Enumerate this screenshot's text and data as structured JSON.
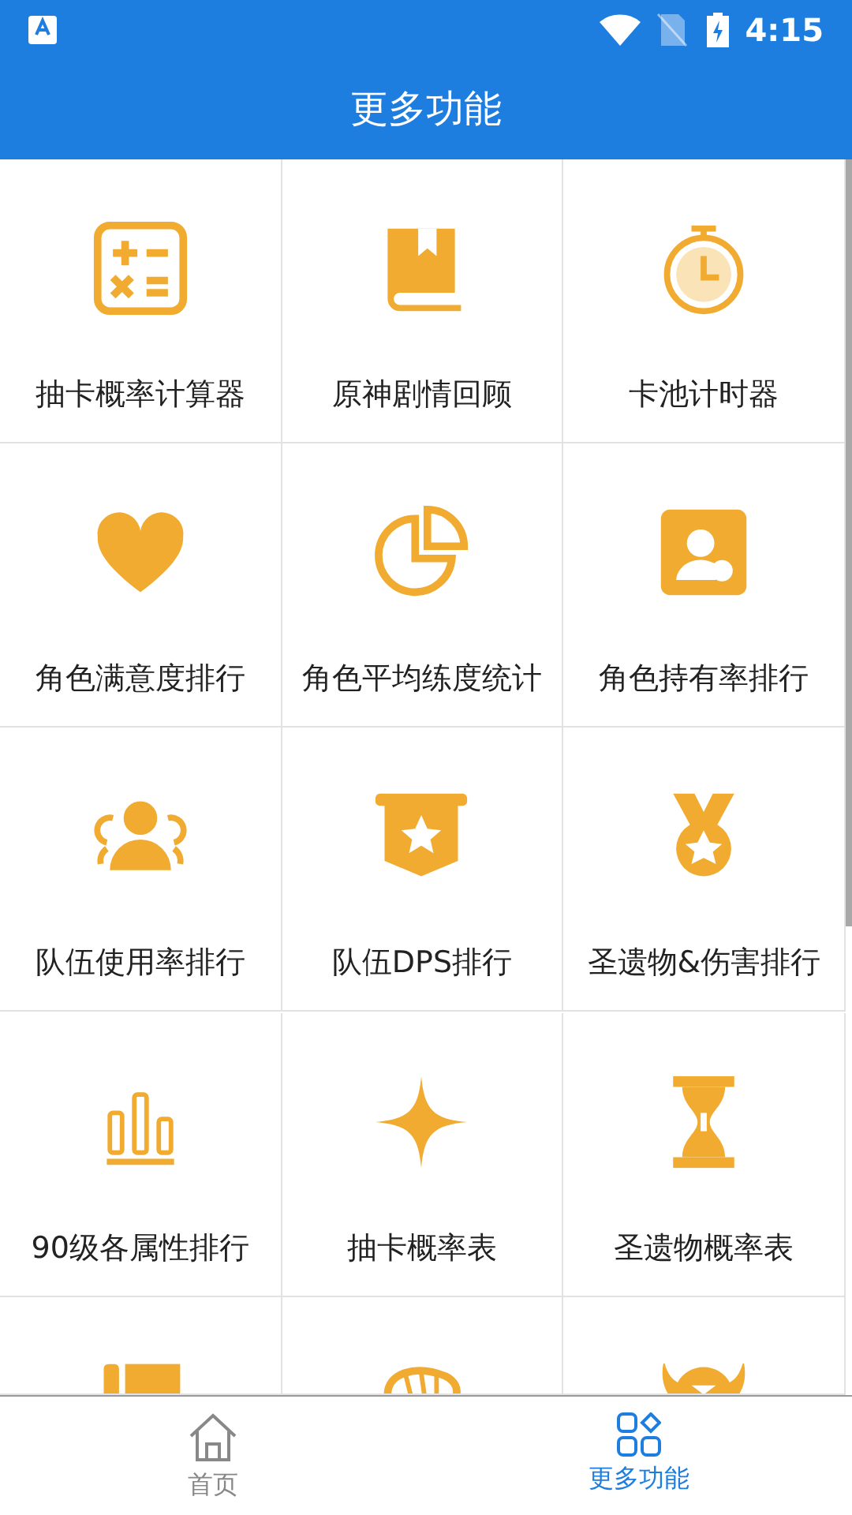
{
  "status_bar": {
    "time": "4:15"
  },
  "header": {
    "title": "更多功能"
  },
  "tools": [
    {
      "label": "抽卡概率计算器"
    },
    {
      "label": "原神剧情回顾"
    },
    {
      "label": "卡池计时器"
    },
    {
      "label": "角色满意度排行"
    },
    {
      "label": "角色平均练度统计"
    },
    {
      "label": "角色持有率排行"
    },
    {
      "label": "队伍使用率排行"
    },
    {
      "label": "队伍DPS排行"
    },
    {
      "label": "圣遗物&伤害排行"
    },
    {
      "label": "90级各属性排行"
    },
    {
      "label": "抽卡概率表"
    },
    {
      "label": "圣遗物概率表"
    },
    {
      "kind": "partial"
    },
    {
      "kind": "partial"
    },
    {
      "kind": "partial"
    }
  ],
  "bottom_nav": [
    {
      "label": "首页",
      "selected": false
    },
    {
      "label": "更多功能",
      "selected": true
    }
  ]
}
